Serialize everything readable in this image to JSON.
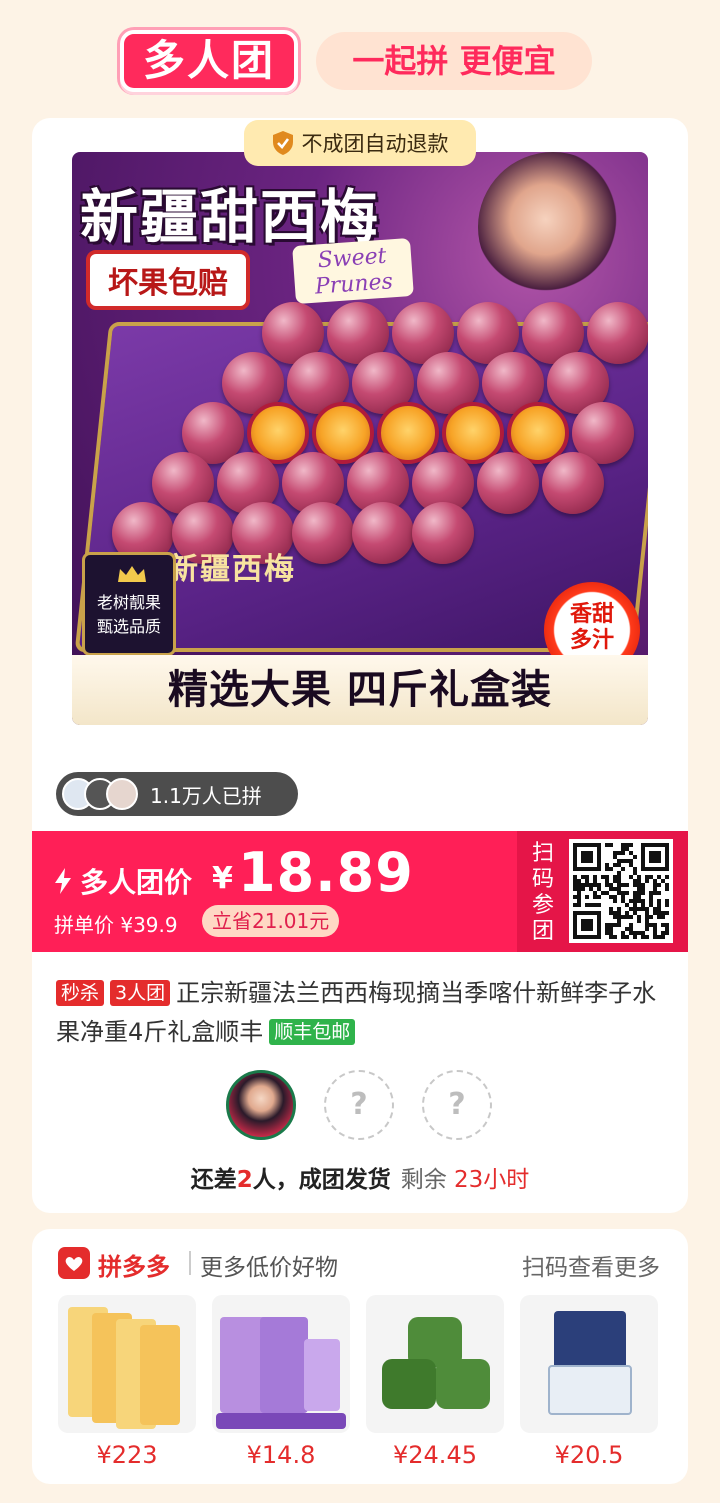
{
  "header": {
    "logo": "多人团",
    "slogan": "一起拼 更便宜"
  },
  "product": {
    "refund_badge": "不成团自动退款",
    "image": {
      "title": "新疆甜西梅",
      "compensate": "坏果包赔",
      "sweet_prunes": "Sweet Prunes",
      "brand": "新疆西梅",
      "badge_line1": "老树靓果",
      "badge_line2": "甄选品质",
      "juicy_line1": "香甜",
      "juicy_line2": "多汁",
      "banner": "精选大果 四斤礼盒装"
    },
    "joined_count": "1.1万人已拼",
    "group_price_label": "多人团价",
    "currency": "¥",
    "group_price": "18.89",
    "single_price": "拼单价 ¥39.9",
    "save": "立省21.01元",
    "scan_label": [
      "扫",
      "码",
      "参",
      "团"
    ],
    "tags": {
      "flash": "秒杀",
      "group": "3人团",
      "shipping": "顺丰包邮"
    },
    "title": "正宗新疆法兰西西梅现摘当季喀什新鲜李子水果净重4斤礼盒顺丰",
    "slots": {
      "empty_mark": "?"
    },
    "need_prefix": "还差",
    "need_count": "2",
    "need_suffix": "人，成团发货",
    "remaining_label": "剩余",
    "remaining_time": "23小时"
  },
  "recommend": {
    "brand": "拼多多",
    "subtitle": "更多低价好物",
    "scan_more": "扫码查看更多",
    "items": [
      {
        "price": "¥223"
      },
      {
        "price": "¥14.8"
      },
      {
        "price": "¥24.45"
      },
      {
        "price": "¥20.5"
      }
    ]
  },
  "colors": {
    "accent": "#ff1f57",
    "red": "#e42c2c",
    "background": "#fdf3e6",
    "green": "#2fb34b"
  }
}
